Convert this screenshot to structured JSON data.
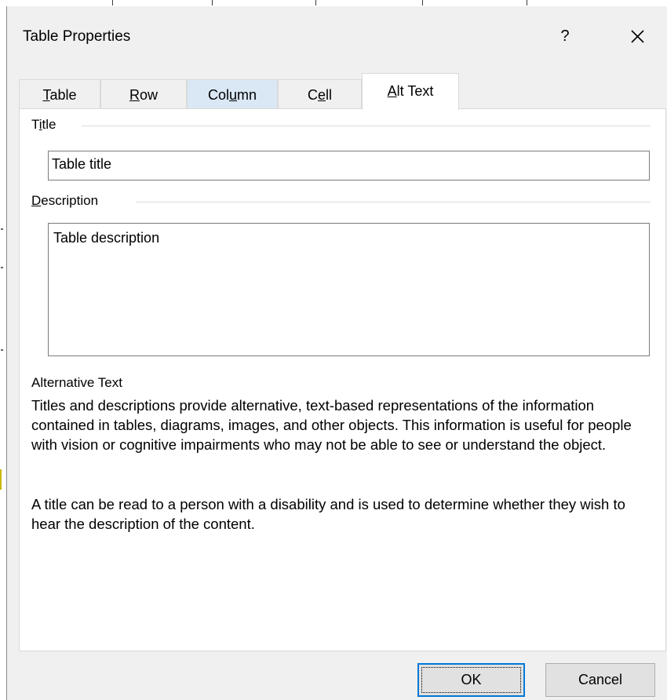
{
  "window": {
    "title": "Table Properties",
    "help_label": "?"
  },
  "tabs": [
    {
      "label": "Table",
      "mnemonic_index": 0,
      "state": "normal"
    },
    {
      "label": "Row",
      "mnemonic_index": 0,
      "state": "normal"
    },
    {
      "label": "Column",
      "mnemonic_index": 3,
      "state": "hover"
    },
    {
      "label": "Cell",
      "mnemonic_index": 1,
      "state": "normal"
    },
    {
      "label": "Alt Text",
      "mnemonic_index": 0,
      "state": "selected"
    }
  ],
  "title_group": {
    "label": "Title",
    "mnemonic_index": 1,
    "value": "Table title"
  },
  "description_group": {
    "label": "Description",
    "mnemonic_index": 0,
    "value": "Table description"
  },
  "alt_text_info": {
    "heading": "Alternative Text",
    "paragraph1": "Titles and descriptions provide alternative, text-based representations of the information contained in tables, diagrams, images, and other objects. This information is useful for people with vision or cognitive impairments who may not be able to see or understand the object.",
    "paragraph2": "A title can be read to a person with a disability and is used to determine whether they wish to hear the description of the content."
  },
  "buttons": {
    "ok": "OK",
    "cancel": "Cancel"
  },
  "colors": {
    "dialog_bg": "#f0f0f0",
    "panel_bg": "#ffffff",
    "tab_hover": "#dae8f5",
    "default_button_border": "#0078d7"
  },
  "icons": {
    "close": "close-icon"
  }
}
